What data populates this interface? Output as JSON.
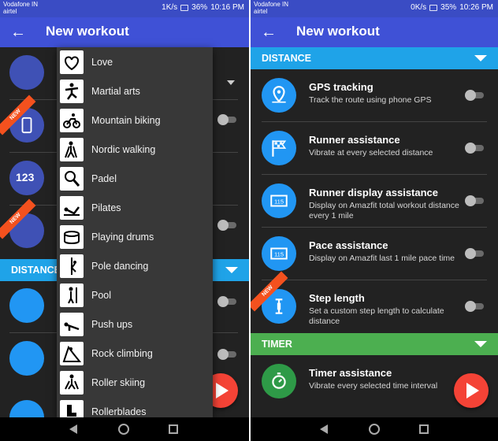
{
  "left": {
    "status": {
      "carrier1": "Vodafone IN",
      "carrier2": "airtel",
      "speed": "1K/s",
      "battery": "36%",
      "time": "10:16 PM"
    },
    "appbar": {
      "title": "New workout"
    },
    "section_label": "DISTANCE",
    "dropdown": [
      {
        "label": "Love",
        "icon": "hearts-icon"
      },
      {
        "label": "Martial arts",
        "icon": "martial-arts-icon"
      },
      {
        "label": "Mountain biking",
        "icon": "mountain-bike-icon"
      },
      {
        "label": "Nordic walking",
        "icon": "nordic-walking-icon"
      },
      {
        "label": "Padel",
        "icon": "padel-icon"
      },
      {
        "label": "Pilates",
        "icon": "pilates-icon"
      },
      {
        "label": "Playing drums",
        "icon": "drum-icon"
      },
      {
        "label": "Pole dancing",
        "icon": "pole-dancing-icon"
      },
      {
        "label": "Pool",
        "icon": "pool-icon"
      },
      {
        "label": "Push ups",
        "icon": "push-ups-icon"
      },
      {
        "label": "Rock climbing",
        "icon": "rock-climbing-icon"
      },
      {
        "label": "Roller skiing",
        "icon": "roller-skiing-icon"
      },
      {
        "label": "Rollerblades",
        "icon": "rollerblades-icon"
      }
    ],
    "new_badge": "NEW"
  },
  "right": {
    "status": {
      "carrier1": "Vodafone IN",
      "carrier2": "airtel",
      "speed": "0K/s",
      "battery": "35%",
      "time": "10:26 PM"
    },
    "appbar": {
      "title": "New workout"
    },
    "sections": {
      "distance": "DISTANCE",
      "timer": "TIMER"
    },
    "rows": [
      {
        "title": "GPS tracking",
        "sub": "Track the route using phone GPS",
        "icon": "map-pin-icon"
      },
      {
        "title": "Runner assistance",
        "sub": "Vibrate at every selected distance",
        "icon": "checkered-flag-icon"
      },
      {
        "title": "Runner display assistance",
        "sub": "Display on Amazfit total workout distance every 1 mile",
        "icon": "display-115-icon"
      },
      {
        "title": "Pace assistance",
        "sub": "Display on Amazfit last 1 mile pace time",
        "icon": "display-115-icon"
      },
      {
        "title": "Step length",
        "sub": "Set a custom step length to calculate distance",
        "icon": "step-length-icon"
      }
    ],
    "timer_row": {
      "title": "Timer assistance",
      "sub": "Vibrate every selected time interval",
      "icon": "stopwatch-icon"
    },
    "new_badge": "NEW"
  },
  "colors": {
    "appbar": "#3f51d6",
    "statusbar": "#3a4cc4",
    "distance_header": "#1fa3e8",
    "timer_header": "#4caf50",
    "fab": "#f44336",
    "badge": "#f4511e"
  }
}
